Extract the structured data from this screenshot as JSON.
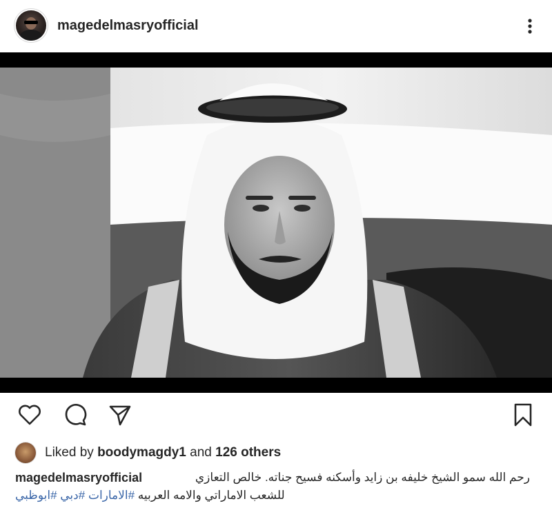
{
  "post": {
    "username": "magedelmasryofficial",
    "more_icon": "more-vertical-icon"
  },
  "actions": {
    "like_icon": "heart-icon",
    "comment_icon": "comment-icon",
    "share_icon": "send-icon",
    "save_icon": "bookmark-icon"
  },
  "likes": {
    "prefix": "Liked by",
    "user": "boodymagdy1",
    "joiner": "and",
    "others": "126 others"
  },
  "caption": {
    "username": "magedelmasryofficial",
    "line1": "رحم الله سمو الشيخ خليفه بن زايد وأسكنه فسيح جناته. خالص التعازي",
    "line2_text": "للشعب الاماراتي والامه العربيه",
    "hashtags": [
      "#الامارات",
      "#دبي",
      "#ابوظبي"
    ]
  },
  "colors": {
    "text": "#262626",
    "hashtag": "#3a66a8",
    "background": "#ffffff"
  }
}
